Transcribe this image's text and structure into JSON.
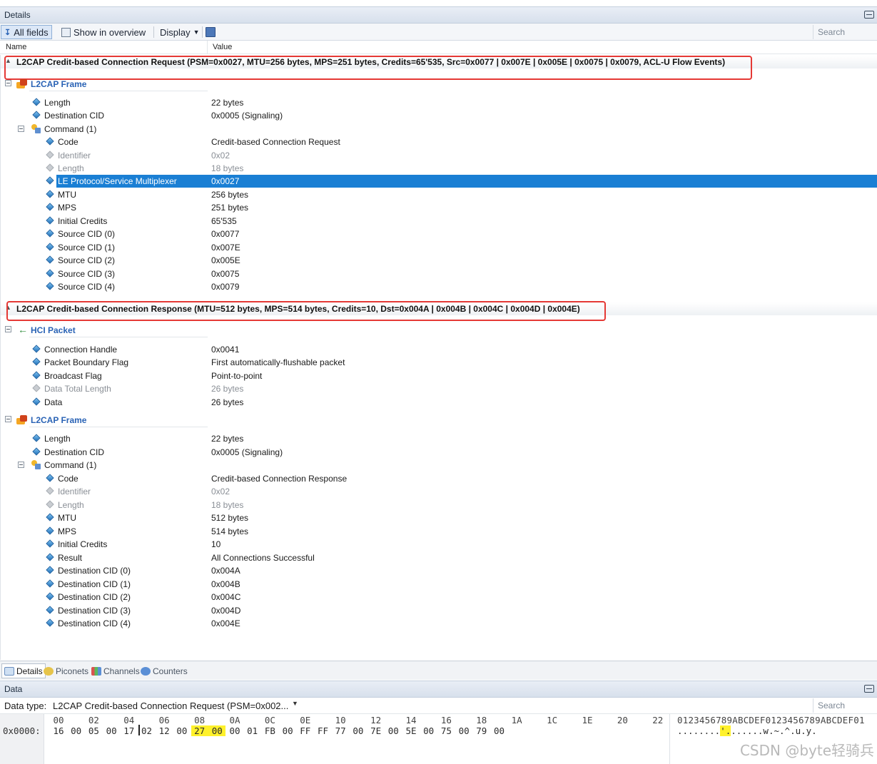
{
  "details_panel": {
    "title": "Details"
  },
  "toolbar": {
    "all_fields": "All fields",
    "show_in_overview": "Show in overview",
    "display": "Display",
    "search_placeholder": "Search"
  },
  "columns": {
    "name": "Name",
    "value": "Value"
  },
  "request": {
    "summary": "L2CAP Credit-based Connection Request (PSM=0x0027, MTU=256 bytes, MPS=251 bytes, Credits=65'535, Src=0x0077 | 0x007E | 0x005E | 0x0075 | 0x0079, ACL-U Flow Events)",
    "group": "L2CAP Frame",
    "fields": [
      {
        "name": "Length",
        "value": "22 bytes"
      },
      {
        "name": "Destination CID",
        "value": "0x0005 (Signaling)"
      }
    ],
    "command": "Command (1)",
    "command_fields": [
      {
        "name": "Code",
        "value": "Credit-based Connection Request"
      },
      {
        "name": "Identifier",
        "value": "0x02"
      },
      {
        "name": "Length",
        "value": "18 bytes"
      },
      {
        "name": "LE Protocol/Service Multiplexer",
        "value": "0x0027"
      },
      {
        "name": "MTU",
        "value": "256 bytes"
      },
      {
        "name": "MPS",
        "value": "251 bytes"
      },
      {
        "name": "Initial Credits",
        "value": "65'535"
      },
      {
        "name": "Source CID (0)",
        "value": "0x0077"
      },
      {
        "name": "Source CID (1)",
        "value": "0x007E"
      },
      {
        "name": "Source CID (2)",
        "value": "0x005E"
      },
      {
        "name": "Source CID (3)",
        "value": "0x0075"
      },
      {
        "name": "Source CID (4)",
        "value": "0x0079"
      }
    ]
  },
  "response": {
    "summary": "L2CAP Credit-based Connection Response (MTU=512 bytes, MPS=514 bytes, Credits=10, Dst=0x004A | 0x004B | 0x004C | 0x004D | 0x004E)",
    "hci_group": "HCI Packet",
    "hci_fields": [
      {
        "name": "Connection Handle",
        "value": "0x0041"
      },
      {
        "name": "Packet Boundary Flag",
        "value": "First automatically-flushable packet"
      },
      {
        "name": "Broadcast Flag",
        "value": "Point-to-point"
      },
      {
        "name": "Data Total Length",
        "value": "26 bytes"
      },
      {
        "name": "Data",
        "value": "26 bytes"
      }
    ],
    "group": "L2CAP Frame",
    "fields": [
      {
        "name": "Length",
        "value": "22 bytes"
      },
      {
        "name": "Destination CID",
        "value": "0x0005 (Signaling)"
      }
    ],
    "command": "Command (1)",
    "command_fields": [
      {
        "name": "Code",
        "value": "Credit-based Connection Response"
      },
      {
        "name": "Identifier",
        "value": "0x02"
      },
      {
        "name": "Length",
        "value": "18 bytes"
      },
      {
        "name": "MTU",
        "value": "512 bytes"
      },
      {
        "name": "MPS",
        "value": "514 bytes"
      },
      {
        "name": "Initial Credits",
        "value": "10"
      },
      {
        "name": "Result",
        "value": "All Connections Successful"
      },
      {
        "name": "Destination CID (0)",
        "value": "0x004A"
      },
      {
        "name": "Destination CID (1)",
        "value": "0x004B"
      },
      {
        "name": "Destination CID (2)",
        "value": "0x004C"
      },
      {
        "name": "Destination CID (3)",
        "value": "0x004D"
      },
      {
        "name": "Destination CID (4)",
        "value": "0x004E"
      }
    ]
  },
  "tabs": [
    "Details",
    "Piconets",
    "Channels",
    "Counters"
  ],
  "data_panel": {
    "title": "Data",
    "type_label": "Data type:",
    "type_value": "L2CAP Credit-based Connection Request (PSM=0x002...",
    "search_placeholder": "Search",
    "header": [
      "00",
      "02",
      "04",
      "06",
      "08",
      "0A",
      "0C",
      "0E",
      "10",
      "12",
      "14",
      "16",
      "18",
      "1A",
      "1C",
      "1E",
      "20",
      "22"
    ],
    "offset": "0x0000:",
    "bytes": [
      "16",
      "00",
      "05",
      "00",
      "17",
      "02",
      "12",
      "00",
      "27",
      "00",
      "00",
      "01",
      "FB",
      "00",
      "FF",
      "FF",
      "77",
      "00",
      "7E",
      "00",
      "5E",
      "00",
      "75",
      "00",
      "79",
      "00"
    ],
    "ascii_header": "0123456789ABCDEF0123456789ABCDEF01",
    "ascii_pre": "........",
    "ascii_hl": "'.",
    "ascii_post": "......w.~.^.u.y."
  },
  "watermark": "CSDN @byte轻骑兵"
}
